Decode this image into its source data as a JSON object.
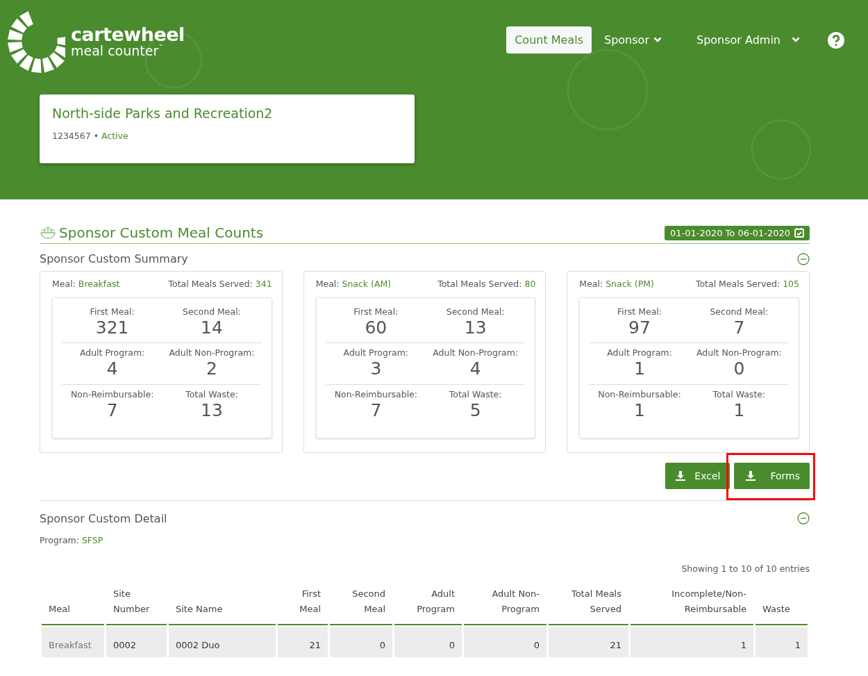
{
  "logo": {
    "name": "cartewheel",
    "tagline": "meal counter",
    "mark": "™"
  },
  "nav": [
    {
      "label": "Count Meals",
      "selected": true,
      "dropdown": false
    },
    {
      "label": "Sponsor",
      "selected": false,
      "dropdown": true
    },
    {
      "label": "Sponsor Admin",
      "selected": false,
      "dropdown": true
    }
  ],
  "sponsor": {
    "name": "North-side Parks and Recreation2",
    "id": "1234567",
    "separator": "•",
    "status": "Active"
  },
  "section": {
    "title": "Sponsor Custom Meal Counts",
    "date_range": "01-01-2020 To 06-01-2020"
  },
  "summary": {
    "title": "Sponsor Custom Summary",
    "expanded": true,
    "cards": [
      {
        "meal_label": "Meal:",
        "meal": "Breakfast",
        "total_label": "Total Meals Served:",
        "total": "341",
        "stats": [
          {
            "label": "First Meal:",
            "value": "321"
          },
          {
            "label": "Second Meal:",
            "value": "14"
          },
          {
            "label": "Adult Program:",
            "value": "4"
          },
          {
            "label": "Adult Non-Program:",
            "value": "2"
          },
          {
            "label": "Non-Reimbursable:",
            "value": "7"
          },
          {
            "label": "Total Waste:",
            "value": "13"
          }
        ]
      },
      {
        "meal_label": "Meal:",
        "meal": "Snack (AM)",
        "total_label": "Total Meals Served:",
        "total": "80",
        "stats": [
          {
            "label": "First Meal:",
            "value": "60"
          },
          {
            "label": "Second Meal:",
            "value": "13"
          },
          {
            "label": "Adult Program:",
            "value": "3"
          },
          {
            "label": "Adult Non-Program:",
            "value": "4"
          },
          {
            "label": "Non-Reimbursable:",
            "value": "7"
          },
          {
            "label": "Total Waste:",
            "value": "5"
          }
        ]
      },
      {
        "meal_label": "Meal:",
        "meal": "Snack (PM)",
        "total_label": "Total Meals Served:",
        "total": "105",
        "stats": [
          {
            "label": "First Meal:",
            "value": "97"
          },
          {
            "label": "Second Meal:",
            "value": "7"
          },
          {
            "label": "Adult Program:",
            "value": "1"
          },
          {
            "label": "Adult Non-Program:",
            "value": "0"
          },
          {
            "label": "Non-Reimbursable:",
            "value": "1"
          },
          {
            "label": "Total Waste:",
            "value": "1"
          }
        ]
      }
    ]
  },
  "buttons": [
    {
      "label": "Excel",
      "highlighted": false
    },
    {
      "label": "Forms",
      "highlighted": true
    }
  ],
  "detail": {
    "title": "Sponsor Custom Detail",
    "expanded": true,
    "program_label": "Program:",
    "program": "SFSP",
    "showing": "Showing 1 to 10 of 10 entries",
    "table": {
      "columns": [
        "Meal",
        "Site Number",
        "Site Name",
        "First Meal",
        "Second Meal",
        "Adult Program",
        "Adult Non-Program",
        "Total Meals Served",
        "Incomplete/Non-Reimbursable",
        "Waste"
      ],
      "rows": [
        [
          "Breakfast",
          "0002",
          "0002 Duo",
          "21",
          "0",
          "0",
          "0",
          "21",
          "1",
          "1"
        ]
      ]
    }
  }
}
